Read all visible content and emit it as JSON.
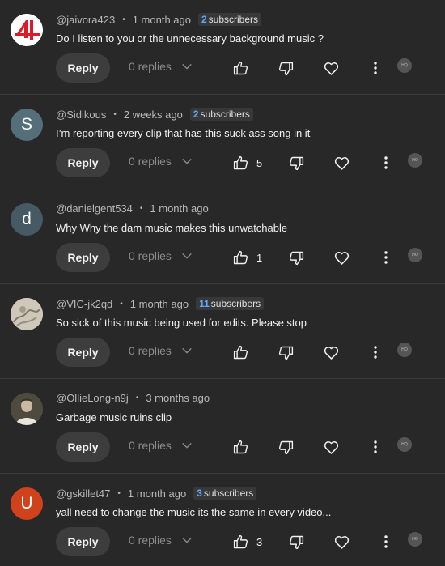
{
  "ui": {
    "reply_label": "Reply",
    "replies_label": "0 replies",
    "badge_text": "HQ"
  },
  "comments": [
    {
      "handle": "@jaivora423",
      "time": "1 month ago",
      "subscribers_count": "2",
      "subscribers_label": "subscribers",
      "text": "Do I listen to you or the unnecessary background music ?",
      "likes": "",
      "avatar_letter": "",
      "avatar_color": "#ffffff"
    },
    {
      "handle": "@Sidikous",
      "time": "2 weeks ago",
      "subscribers_count": "2",
      "subscribers_label": "subscribers",
      "text": "I’m reporting every clip that has this suck ass song in it",
      "likes": "5",
      "avatar_letter": "S",
      "avatar_color": "#546e7a"
    },
    {
      "handle": "@danielgent534",
      "time": "1 month ago",
      "subscribers_count": "",
      "subscribers_label": "",
      "text": "Why Why the dam music makes this unwatchable",
      "likes": "1",
      "avatar_letter": "d",
      "avatar_color": "#455a64"
    },
    {
      "handle": "@VIC-jk2qd",
      "time": "1 month ago",
      "subscribers_count": "11",
      "subscribers_label": "subscribers",
      "text": "So sick of this music being used for edits. Please stop",
      "likes": "",
      "avatar_letter": "",
      "avatar_color": "#c9c2b4"
    },
    {
      "handle": "@OllieLong-n9j",
      "time": "3 months ago",
      "subscribers_count": "",
      "subscribers_label": "",
      "text": "Garbage music ruins clip",
      "likes": "",
      "avatar_letter": "",
      "avatar_color": "#5b5748"
    },
    {
      "handle": "@gskillet47",
      "time": "1 month ago",
      "subscribers_count": "3",
      "subscribers_label": "subscribers",
      "text": "yall need to change the music its the same in every video...",
      "likes": "3",
      "avatar_letter": "U",
      "avatar_color": "#d0421b"
    }
  ]
}
